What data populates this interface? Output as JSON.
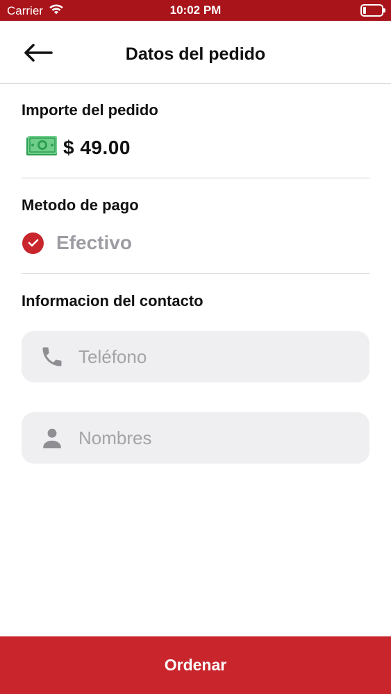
{
  "status_bar": {
    "carrier": "Carrier",
    "time": "10:02 PM",
    "icons": [
      "wifi-icon",
      "battery-icon"
    ]
  },
  "nav": {
    "title": "Datos del pedido",
    "back_icon": "arrow-left-icon"
  },
  "order_amount": {
    "title": "Importe del pedido",
    "icon": "money-bill-icon",
    "value": "$ 49.00"
  },
  "payment": {
    "title": "Metodo de pago",
    "icon": "check-circle-icon",
    "method": "Efectivo"
  },
  "contact": {
    "title": "Informacion del contacto",
    "phone": {
      "icon": "phone-icon",
      "placeholder": "Teléfono",
      "value": ""
    },
    "name": {
      "icon": "person-icon",
      "placeholder": "Nombres",
      "value": ""
    }
  },
  "actions": {
    "order_label": "Ordenar"
  },
  "colors": {
    "status_bar": "#a8141a",
    "accent": "#c8262c",
    "field_bg": "#efeff1",
    "muted_text": "#9c9ca3"
  }
}
